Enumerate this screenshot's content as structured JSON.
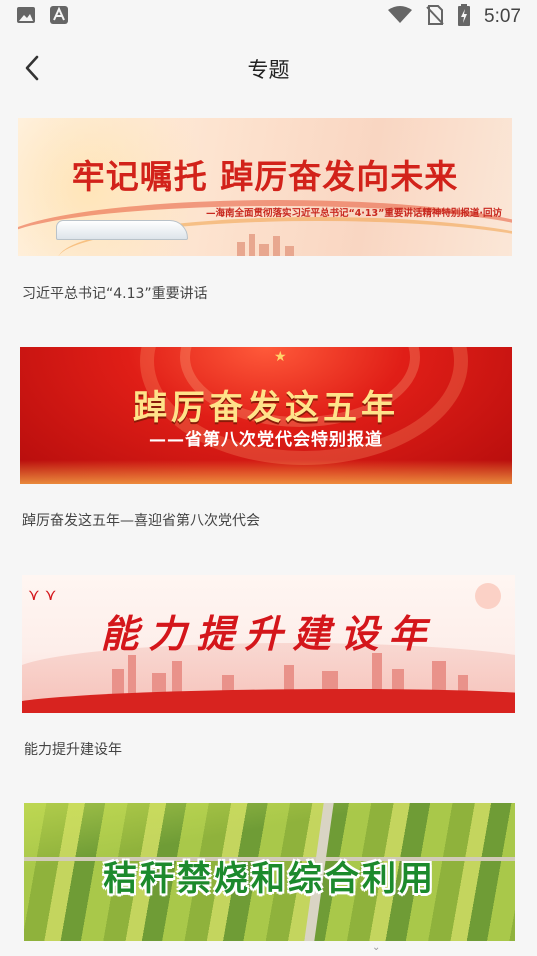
{
  "status_bar": {
    "time": "5:07",
    "icons": [
      "image-icon",
      "a-notification-icon",
      "wifi-icon",
      "no-sim-icon",
      "battery-charging-icon"
    ]
  },
  "nav": {
    "title": "专题",
    "back_icon": "chevron-left-icon"
  },
  "topics": [
    {
      "banner_headline": "牢记嘱托  踔厉奋发向未来",
      "banner_subtitle": "—海南全面贯彻落实习近平总书记“4·13”重要讲话精神特别报道·回访",
      "caption": "习近平总书记“4.13”重要讲话"
    },
    {
      "banner_headline": "踔厉奋发这五年",
      "banner_subtitle": "——省第八次党代会特别报道",
      "caption": "踔厉奋发这五年—喜迎省第八次党代会"
    },
    {
      "banner_headline": "能力提升建设年",
      "caption": "能力提升建设年"
    },
    {
      "banner_headline": "秸秆禁烧和综合利用"
    }
  ],
  "colors": {
    "page_bg": "#f6f6f6",
    "banner_red": "#d2221a",
    "banner_green": "#1c8a2c"
  }
}
